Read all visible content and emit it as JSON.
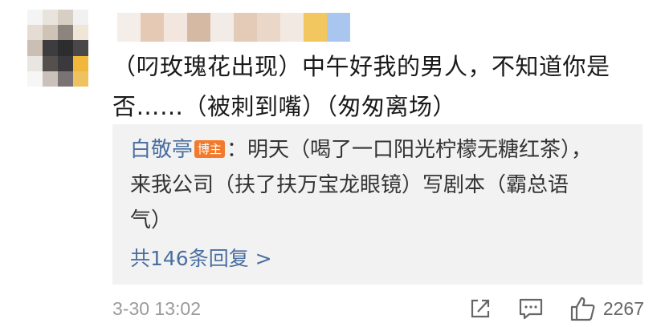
{
  "comment": {
    "text": "（叼玫瑰花出现）中午好我的男人，不知道你是否……（被刺到嘴）（匆匆离场）"
  },
  "reply": {
    "author": "白敬亭",
    "badge": "博主",
    "text": "：明天（喝了一口阳光柠檬无糖红茶），来我公司（扶了扶万宝龙眼镜）写剧本（霸总语气）",
    "more_replies": "共146条回复 >"
  },
  "footer": {
    "timestamp": "3-30 13:02",
    "like_count": "2267"
  },
  "icons": {
    "share": "share-icon",
    "comment": "comment-icon",
    "like": "thumbs-up-icon"
  },
  "colors": {
    "author_link": "#4a6fa0",
    "badge_bg": "#f37a2c",
    "reply_bg": "#f2f2f2",
    "meta_gray": "#9a9a9a"
  }
}
